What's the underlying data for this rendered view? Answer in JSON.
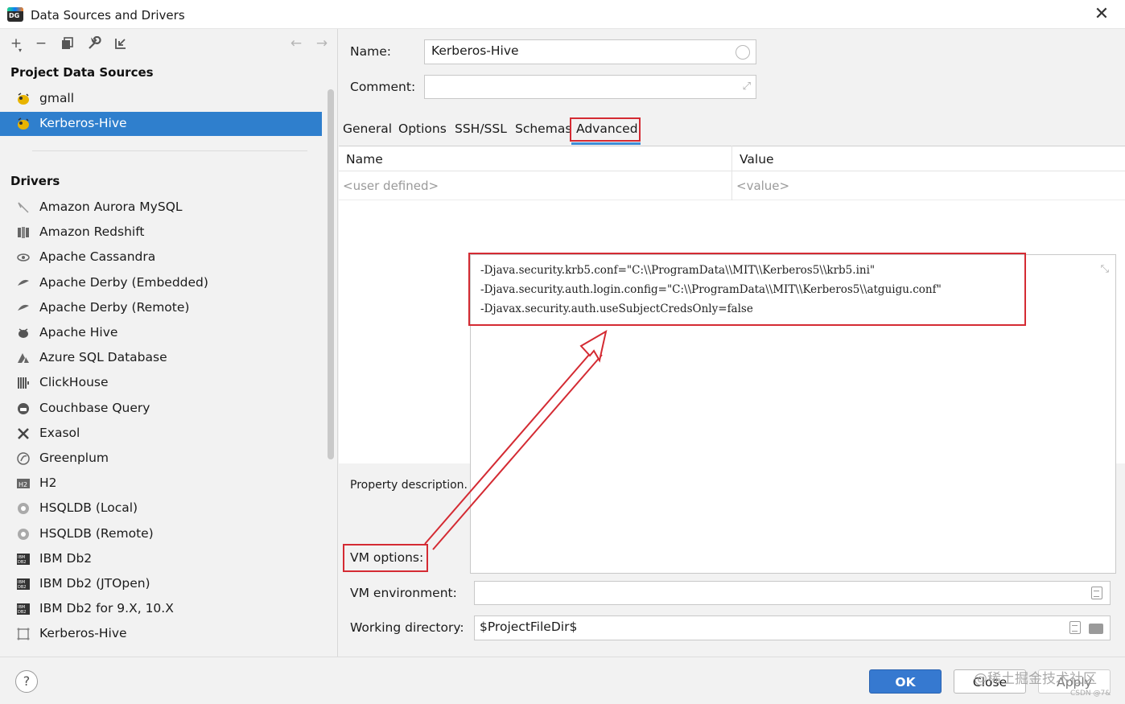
{
  "window": {
    "title": "Data Sources and Drivers",
    "app_icon_text": "DG"
  },
  "sidebar": {
    "section_project": "Project Data Sources",
    "project_items": [
      {
        "label": "gmall",
        "icon": "hive-icon"
      },
      {
        "label": "Kerberos-Hive",
        "icon": "hive-icon",
        "selected": true
      }
    ],
    "section_drivers": "Drivers",
    "drivers": [
      {
        "label": "Amazon Aurora MySQL",
        "icon": "aurora-icon"
      },
      {
        "label": "Amazon Redshift",
        "icon": "redshift-icon"
      },
      {
        "label": "Apache Cassandra",
        "icon": "cassandra-icon"
      },
      {
        "label": "Apache Derby (Embedded)",
        "icon": "derby-icon"
      },
      {
        "label": "Apache Derby (Remote)",
        "icon": "derby-icon"
      },
      {
        "label": "Apache Hive",
        "icon": "hive-icon"
      },
      {
        "label": "Azure SQL Database",
        "icon": "azure-icon"
      },
      {
        "label": "ClickHouse",
        "icon": "clickhouse-icon"
      },
      {
        "label": "Couchbase Query",
        "icon": "couchbase-icon"
      },
      {
        "label": "Exasol",
        "icon": "exasol-icon"
      },
      {
        "label": "Greenplum",
        "icon": "greenplum-icon"
      },
      {
        "label": "H2",
        "icon": "h2-icon"
      },
      {
        "label": "HSQLDB (Local)",
        "icon": "hsqldb-icon"
      },
      {
        "label": "HSQLDB (Remote)",
        "icon": "hsqldb-icon"
      },
      {
        "label": "IBM Db2",
        "icon": "ibm-db2-icon"
      },
      {
        "label": "IBM Db2 (JTOpen)",
        "icon": "ibm-db2-icon"
      },
      {
        "label": "IBM Db2 for 9.X, 10.X",
        "icon": "ibm-db2-icon"
      },
      {
        "label": "Kerberos-Hive",
        "icon": "driver-generic-icon"
      }
    ]
  },
  "form": {
    "name_label": "Name:",
    "name_value": "Kerberos-Hive",
    "comment_label": "Comment:",
    "comment_value": ""
  },
  "tabs": [
    "General",
    "Options",
    "SSH/SSL",
    "Schemas",
    "Advanced"
  ],
  "active_tab": "Advanced",
  "properties_table": {
    "headers": [
      "Name",
      "Value"
    ],
    "placeholder_row": [
      "<user defined>",
      "<value>"
    ]
  },
  "property_description": "Property description.",
  "vm_options": {
    "label": "VM options:",
    "lines": [
      "-Djava.security.krb5.conf=\"C:\\\\ProgramData\\\\MIT\\\\Kerberos5\\\\krb5.ini\"",
      "-Djava.security.auth.login.config=\"C:\\\\ProgramData\\\\MIT\\\\Kerberos5\\\\atguigu.conf\"",
      "-Djavax.security.auth.useSubjectCredsOnly=false"
    ]
  },
  "vm_environment": {
    "label": "VM environment:",
    "value": ""
  },
  "working_directory": {
    "label": "Working directory:",
    "value": "$ProjectFileDir$"
  },
  "buttons": {
    "ok": "OK",
    "close": "Close",
    "apply": "Apply",
    "help": "?"
  },
  "watermark": "@稀土掘金技术社区",
  "watermark_small": "CSDN @7&",
  "colors": {
    "selection": "#2f7fcd",
    "annotation_red": "#d42b33",
    "tab_underline": "#3d8dd7",
    "ok_button": "#3679d0"
  }
}
